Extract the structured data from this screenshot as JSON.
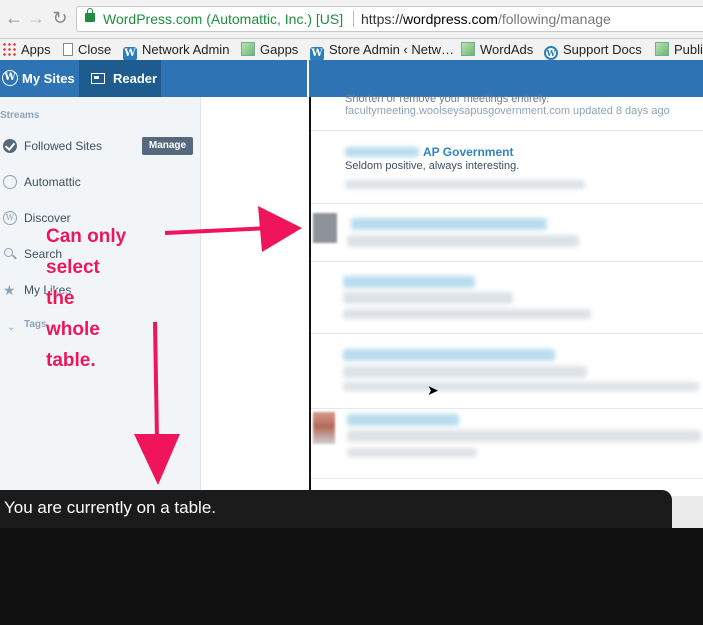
{
  "browser": {
    "secure_label": "WordPress.com (Automattic, Inc.) [US]",
    "url_scheme": "https://",
    "url_host": "wordpress.com",
    "url_path": "/following/manage"
  },
  "bookmarks": [
    {
      "label": "Apps",
      "icon": "apps-icon"
    },
    {
      "label": "Close",
      "icon": "page-icon"
    },
    {
      "label": "Network Admin",
      "icon": "wordpress-icon"
    },
    {
      "label": "Gapps",
      "icon": "image-icon"
    },
    {
      "label": "Store Admin ‹ Netw…",
      "icon": "wordpress-icon"
    },
    {
      "label": "WordAds",
      "icon": "image-icon"
    },
    {
      "label": "Support Docs",
      "icon": "wordpress-circle-icon"
    },
    {
      "label": "Publi",
      "icon": "image-icon"
    }
  ],
  "masterbar": {
    "my_sites": "My Sites",
    "reader": "Reader"
  },
  "sidebar": {
    "streams_label": "Streams",
    "items": [
      {
        "label": "Followed Sites"
      },
      {
        "label": "Automattic"
      },
      {
        "label": "Discover"
      },
      {
        "label": "Search"
      },
      {
        "label": "My Likes"
      }
    ],
    "manage_label": "Manage",
    "tags_label": "Tags"
  },
  "feed": {
    "row0_top": "Shorten or remove your meetings entirely.",
    "row0_sub": "facultymeeting.woolseysapusgovernment.com  updated 8 days ago",
    "row1_title": "AP Government",
    "row1_desc": "Seldom positive, always interesting."
  },
  "annotation": {
    "lines": [
      "Can only",
      "select",
      "the",
      "whole",
      "table."
    ],
    "color": "#f0145a"
  },
  "screen_reader": {
    "text": "You are currently on a table."
  }
}
